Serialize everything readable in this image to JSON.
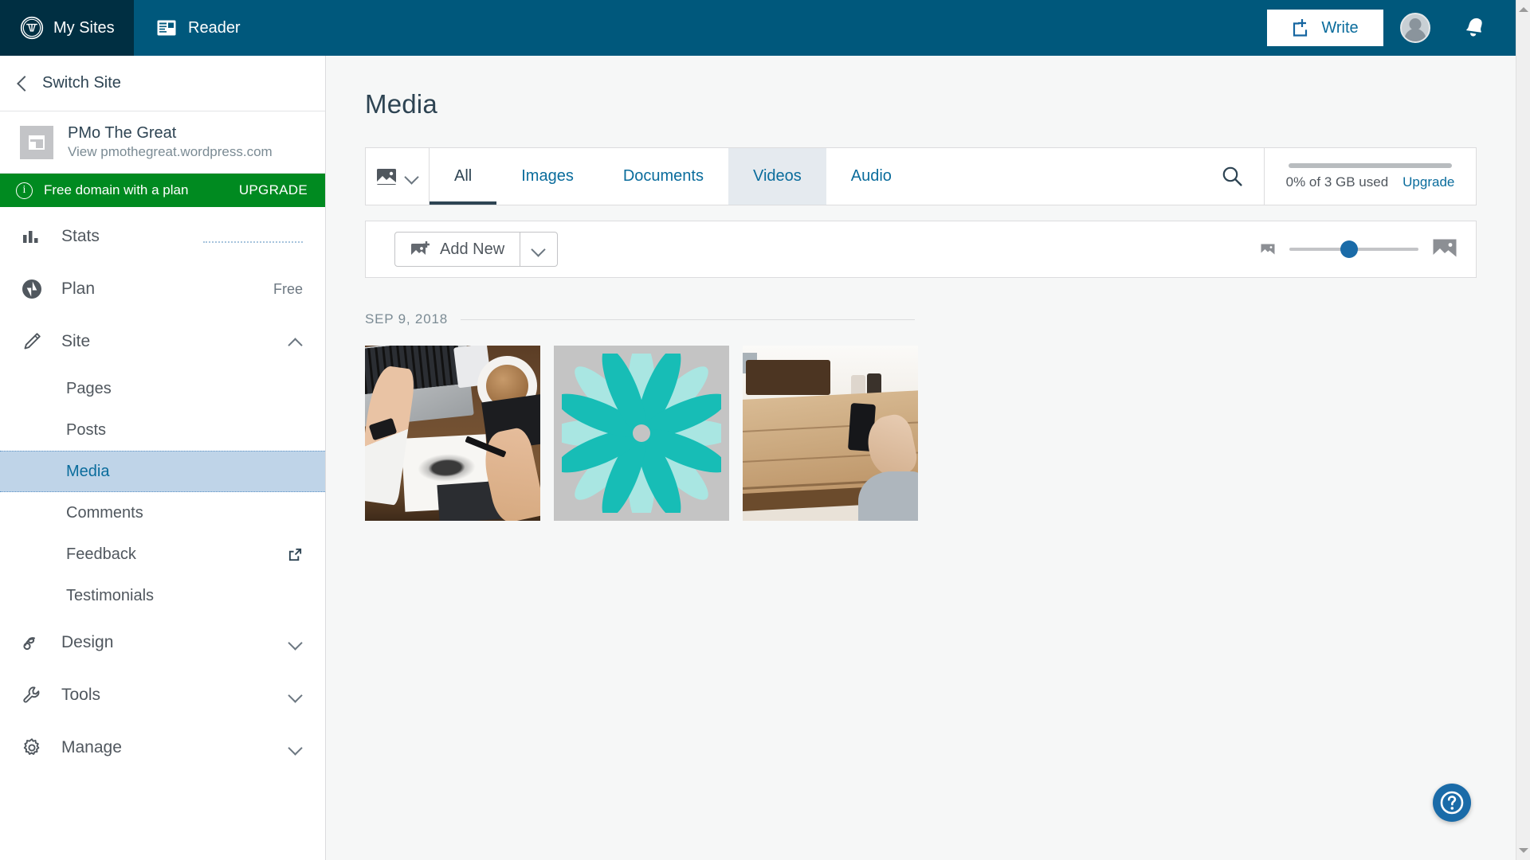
{
  "masthead": {
    "my_sites_label": "My Sites",
    "reader_label": "Reader",
    "write_label": "Write",
    "wp_logo_icon": "wordpress-logo-icon",
    "reader_icon": "reader-icon",
    "write_icon": "write-plus-icon",
    "avatar_icon": "user-avatar",
    "bell_icon": "notifications-bell-icon",
    "bg_color": "#00587c",
    "mysites_bg_color": "#002f42"
  },
  "sidebar": {
    "switch_site_label": "Switch Site",
    "back_icon": "chevron-left-icon",
    "site": {
      "name": "PMo The Great",
      "url_label": "View pmothegreat.wordpress.com",
      "thumb_icon": "site-layout-icon"
    },
    "banner": {
      "icon": "info-circle-icon",
      "text": "Free domain with a plan",
      "action": "UPGRADE",
      "bg_color": "#008a20"
    },
    "items": [
      {
        "label": "Stats",
        "icon": "stats-bars-icon",
        "meta": "",
        "sparkline": true
      },
      {
        "label": "Plan",
        "icon": "plan-jetpack-icon",
        "meta": "Free"
      },
      {
        "label": "Site",
        "icon": "pencil-icon",
        "meta": "",
        "expander": "chevron-up-icon",
        "expanded": true
      }
    ],
    "site_children": [
      {
        "label": "Pages",
        "selected": false
      },
      {
        "label": "Posts",
        "selected": false
      },
      {
        "label": "Media",
        "selected": true
      },
      {
        "label": "Comments",
        "selected": false
      },
      {
        "label": "Feedback",
        "selected": false,
        "icon": "external-link-icon"
      },
      {
        "label": "Testimonials",
        "selected": false
      }
    ],
    "items_bottom": [
      {
        "label": "Design",
        "icon": "design-brush-icon",
        "expander": "chevron-down-icon"
      },
      {
        "label": "Tools",
        "icon": "wrench-icon",
        "expander": "chevron-down-icon"
      },
      {
        "label": "Manage",
        "icon": "gear-icon",
        "expander": "chevron-down-icon"
      }
    ]
  },
  "main": {
    "page_title": "Media",
    "filter": {
      "icon": "image-filter-icon",
      "caret_icon": "chevron-down-icon"
    },
    "tabs": [
      {
        "label": "All",
        "state": "active"
      },
      {
        "label": "Images",
        "state": "default"
      },
      {
        "label": "Documents",
        "state": "default"
      },
      {
        "label": "Videos",
        "state": "hovered"
      },
      {
        "label": "Audio",
        "state": "default"
      }
    ],
    "search_icon": "search-icon",
    "storage": {
      "usage_text": "0% of 3 GB used",
      "upgrade_label": "Upgrade",
      "percent": 0,
      "bar_color": "#b8bcbf"
    },
    "toolbar": {
      "add_new_label": "Add New",
      "add_new_icon": "image-add-icon",
      "add_new_caret_icon": "chevron-down-icon",
      "scale_small_icon": "small-thumbnail-icon",
      "scale_large_icon": "large-thumbnail-icon",
      "scale_value": 46,
      "slider_thumb_color": "#1a6ba8"
    },
    "date_group_label": "SEP 9, 2018",
    "media_items": [
      {
        "name": "media-thumbnail-desk-laptop",
        "kind": "photo-desk"
      },
      {
        "name": "media-thumbnail-flower-graphic",
        "kind": "graphic-flower"
      },
      {
        "name": "media-thumbnail-table-phone",
        "kind": "photo-table"
      }
    ],
    "help_icon": "help-question-icon",
    "help_color": "#1a6ba8"
  },
  "scrollbar": {
    "up_icon": "scroll-up-arrow",
    "down_icon": "scroll-down-arrow"
  }
}
